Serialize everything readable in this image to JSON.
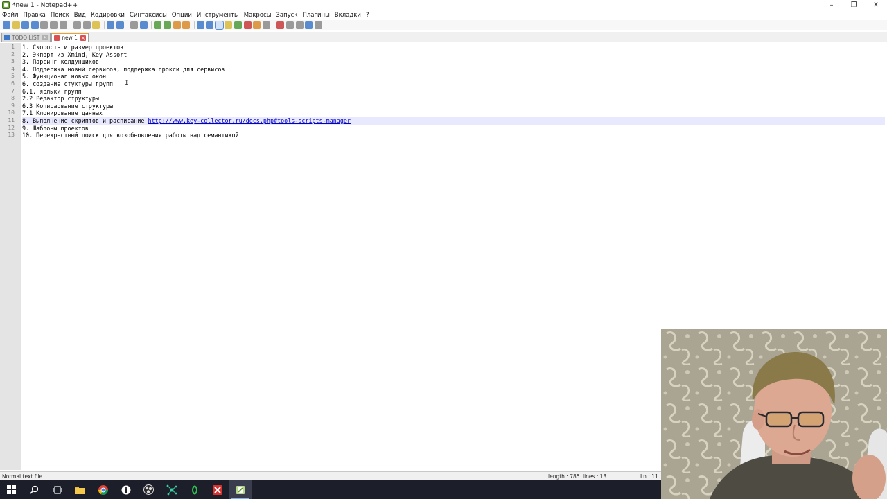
{
  "window": {
    "title": "*new 1 - Notepad++",
    "controls": {
      "minimize": "–",
      "maximize": "❐",
      "close": "✕"
    }
  },
  "menu": [
    "Файл",
    "Правка",
    "Поиск",
    "Вид",
    "Кодировки",
    "Синтаксисы",
    "Опции",
    "Инструменты",
    "Макросы",
    "Запуск",
    "Плагины",
    "Вкладки",
    "?"
  ],
  "toolbar": {
    "buttons": [
      "new-file-icon",
      "open-file-icon",
      "save-icon",
      "save-all-icon",
      "close-icon",
      "close-all-icon",
      "print-icon",
      "cut-icon",
      "copy-icon",
      "paste-icon",
      "undo-icon",
      "redo-icon",
      "find-icon",
      "replace-icon",
      "zoom-in-icon",
      "zoom-out-icon",
      "sync-v-icon",
      "sync-h-icon",
      "wrap-icon",
      "all-chars-icon",
      "indent-guide-icon",
      "udl-icon",
      "doc-map-icon",
      "function-list-icon",
      "folder-workspace-icon",
      "monitor-icon",
      "record-macro-icon",
      "stop-macro-icon",
      "play-macro-icon",
      "run-macro-multiple-icon",
      "save-macro-icon"
    ],
    "colors": {
      "blue": "#3c78c8",
      "green": "#4e9a3a",
      "orange": "#d88a2a",
      "red": "#c83a3a",
      "gray": "#8a8a8a",
      "yellow": "#d8b83a"
    }
  },
  "tabs": [
    {
      "label": "TODO LIST",
      "active": false
    },
    {
      "label": "new 1",
      "active": true
    }
  ],
  "editor": {
    "current_line": 11,
    "lines": [
      {
        "num": "1",
        "text": "1. Скорость и размер проектов"
      },
      {
        "num": "2",
        "text": "2. Экпорт из Xmind, Key Assort"
      },
      {
        "num": "3",
        "text": "3. Парсинг колдунщиков"
      },
      {
        "num": "4",
        "text": "4. Поддержка новый сервисов, поддержка прокси для сервисов"
      },
      {
        "num": "5",
        "text": "5. Функционал новых окон"
      },
      {
        "num": "6",
        "text": "6. создание стуктуры групп"
      },
      {
        "num": "7",
        "text": "6.1. ярлыки групп"
      },
      {
        "num": "8",
        "text": "2.2 Редактор структуры"
      },
      {
        "num": "9",
        "text": "6.3 Копираование структуры"
      },
      {
        "num": "10",
        "text": "7.1 Клонирование данных"
      },
      {
        "num": "11",
        "text": "8. Выполнение скриптов и расписание ",
        "url": "http://www.key-collector.ru/docs.php#tools-scripts-manager"
      },
      {
        "num": "12",
        "text": "9. Шаблоны проектов"
      },
      {
        "num": "13",
        "text": "10. Перекрестный поиск для возобновления работы над семантикой"
      }
    ]
  },
  "status": {
    "type": "Normal text file",
    "length": "length : 785",
    "lines": "lines : 13",
    "ln": "Ln : 11"
  },
  "taskbar": {
    "items": [
      "windows-start-icon",
      "search-icon",
      "task-view-icon",
      "file-explorer-icon",
      "chrome-icon",
      "info-app-icon",
      "obs-icon",
      "network-app-icon",
      "green-app-icon",
      "red-app-icon",
      "notepadpp-icon"
    ],
    "colors": {
      "background": "#1c1e2a",
      "accent": "#7fb2ef"
    }
  }
}
